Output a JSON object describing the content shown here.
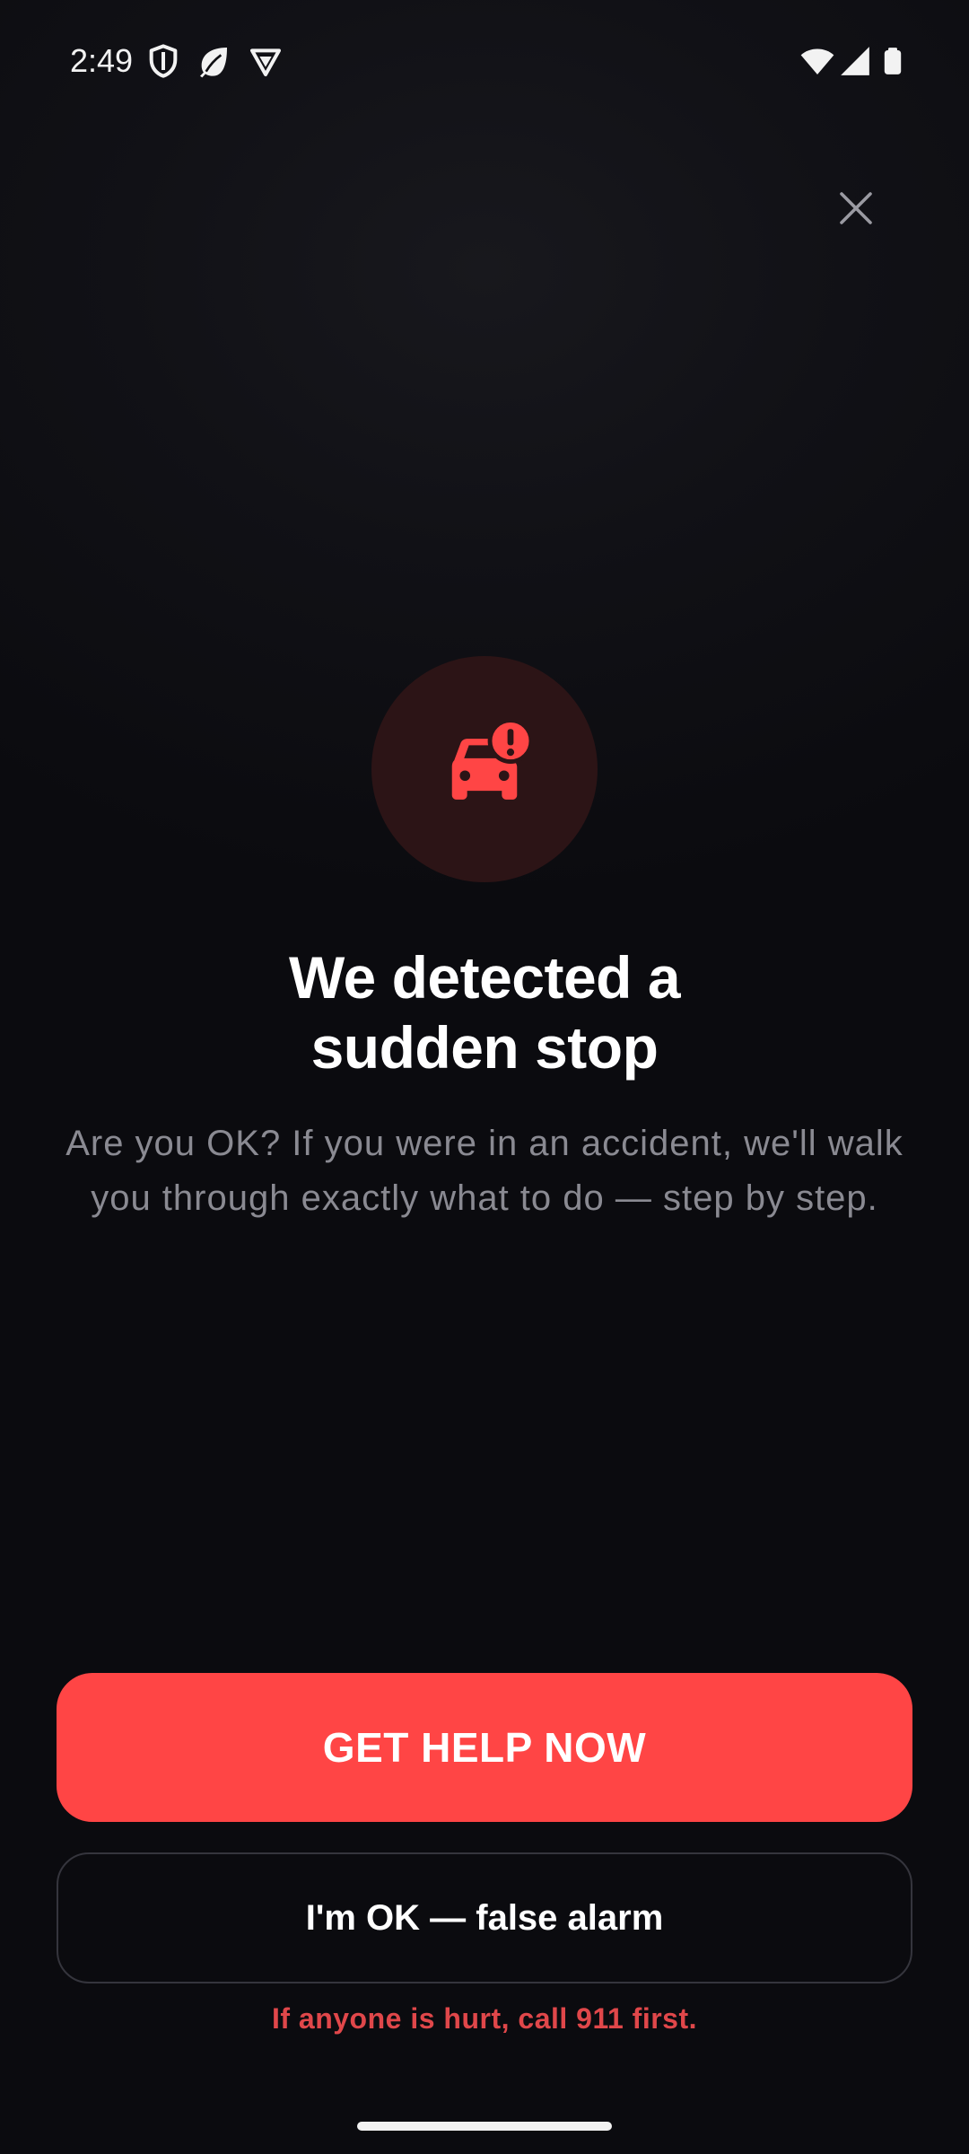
{
  "status_bar": {
    "time": "2:49",
    "left_icons": [
      "shield-icon",
      "leaf-icon",
      "vpn-badge-icon"
    ],
    "right_icons": [
      "wifi-icon",
      "cell-signal-icon",
      "battery-icon"
    ]
  },
  "close": {
    "icon": "close-icon"
  },
  "alert": {
    "icon": "car-alert-icon",
    "icon_color": "#ff4545",
    "circle_color": "#2c1416"
  },
  "headline": {
    "line1": "We detected a",
    "line2": "sudden stop"
  },
  "description": "Are you OK? If you were in an accident, we'll walk you through exactly what to do — step by step.",
  "actions": {
    "primary_label": "GET HELP NOW",
    "primary_color": "#ff4545",
    "secondary_label": "I'm OK — false alarm"
  },
  "warning": "If anyone is hurt, call 911 first."
}
